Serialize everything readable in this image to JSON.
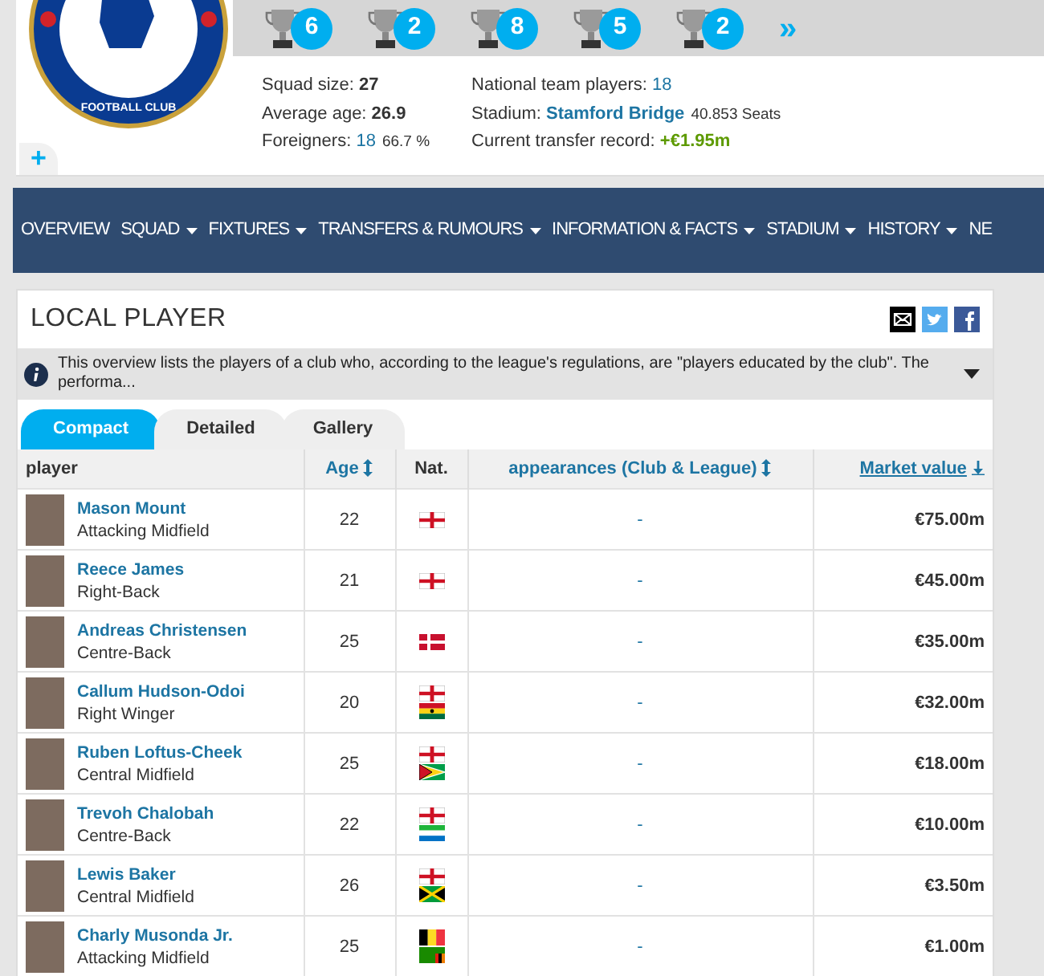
{
  "club_crest": {
    "text": "FOOTBALL CLUB"
  },
  "trophies": [
    {
      "count": "6"
    },
    {
      "count": "2"
    },
    {
      "count": "8"
    },
    {
      "count": "5"
    },
    {
      "count": "2"
    }
  ],
  "trophies_more": "»",
  "stats_left": [
    {
      "label": "Squad size:",
      "value": "27",
      "kind": "bold"
    },
    {
      "label": "Average age:",
      "value": "26.9",
      "kind": "bold"
    },
    {
      "label": "Foreigners:",
      "value": "18",
      "kind": "link",
      "extra": "66.7 %"
    }
  ],
  "stats_right": [
    {
      "label": "National team players:",
      "value": "18",
      "kind": "link"
    },
    {
      "label": "Stadium:",
      "value": "Stamford Bridge",
      "kind": "boldlink",
      "extra": "40.853 Seats"
    },
    {
      "label": "Current transfer record:",
      "value": "+€1.95m",
      "kind": "positive"
    }
  ],
  "expand_button": "+",
  "nav": [
    {
      "label": "OVERVIEW",
      "dropdown": false
    },
    {
      "label": "SQUAD",
      "dropdown": true
    },
    {
      "label": "FIXTURES",
      "dropdown": true
    },
    {
      "label": "TRANSFERS & RUMOURS",
      "dropdown": true
    },
    {
      "label": "INFORMATION & FACTS",
      "dropdown": true
    },
    {
      "label": "STADIUM",
      "dropdown": true
    },
    {
      "label": "HISTORY",
      "dropdown": true
    },
    {
      "label": "NE",
      "dropdown": false
    }
  ],
  "section": {
    "title": "LOCAL PLAYER",
    "info": "This overview lists the players of a club who, according to the league's regulations, are \"players educated by the club\". The performa..."
  },
  "tabs": [
    {
      "label": "Compact",
      "selected": true
    },
    {
      "label": "Detailed",
      "selected": false
    },
    {
      "label": "Gallery",
      "selected": false
    }
  ],
  "table": {
    "columns": [
      {
        "label": "player",
        "kind": "plain"
      },
      {
        "label": "Age",
        "kind": "sort"
      },
      {
        "label": "Nat.",
        "kind": "plain"
      },
      {
        "label": "appearances (Club & League)",
        "kind": "sort"
      },
      {
        "label": "Market value",
        "kind": "sorted"
      }
    ],
    "rows": [
      {
        "name": "Mason Mount",
        "position": "Attacking Midfield",
        "age": "22",
        "flags": [
          {
            "kind": "england"
          }
        ],
        "appearances": "-",
        "value": "€75.00m"
      },
      {
        "name": "Reece James",
        "position": "Right-Back",
        "age": "21",
        "flags": [
          {
            "kind": "england"
          }
        ],
        "appearances": "-",
        "value": "€45.00m"
      },
      {
        "name": "Andreas Christensen",
        "position": "Centre-Back",
        "age": "25",
        "flags": [
          {
            "kind": "denmark"
          }
        ],
        "appearances": "-",
        "value": "€35.00m"
      },
      {
        "name": "Callum Hudson-Odoi",
        "position": "Right Winger",
        "age": "20",
        "flags": [
          {
            "kind": "england"
          },
          {
            "kind": "ghana"
          }
        ],
        "appearances": "-",
        "value": "€32.00m"
      },
      {
        "name": "Ruben Loftus-Cheek",
        "position": "Central Midfield",
        "age": "25",
        "flags": [
          {
            "kind": "england"
          },
          {
            "kind": "guyana"
          }
        ],
        "appearances": "-",
        "value": "€18.00m"
      },
      {
        "name": "Trevoh Chalobah",
        "position": "Centre-Back",
        "age": "22",
        "flags": [
          {
            "kind": "england"
          },
          {
            "kind": "sierra-leone"
          }
        ],
        "appearances": "-",
        "value": "€10.00m"
      },
      {
        "name": "Lewis Baker",
        "position": "Central Midfield",
        "age": "26",
        "flags": [
          {
            "kind": "england"
          },
          {
            "kind": "jamaica"
          }
        ],
        "appearances": "-",
        "value": "€3.50m"
      },
      {
        "name": "Charly Musonda Jr.",
        "position": "Attacking Midfield",
        "age": "25",
        "flags": [
          {
            "kind": "belgium"
          },
          {
            "kind": "zambia"
          }
        ],
        "appearances": "-",
        "value": "€1.00m"
      }
    ]
  }
}
